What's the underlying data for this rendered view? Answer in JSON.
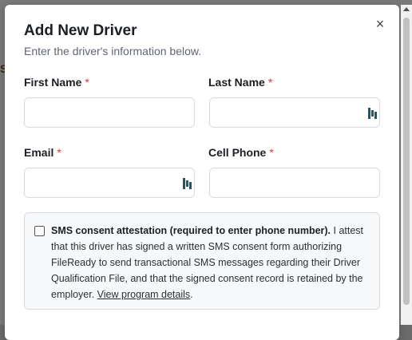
{
  "dialog": {
    "title": "Add New Driver",
    "subtitle": "Enter the driver's information below.",
    "close_glyph": "×"
  },
  "fields": {
    "first_name": {
      "label": "First Name",
      "required_mark": "*",
      "value": "",
      "placeholder": ""
    },
    "last_name": {
      "label": "Last Name",
      "required_mark": "*",
      "value": "",
      "placeholder": "",
      "icon": "password-manager-icon"
    },
    "email": {
      "label": "Email",
      "required_mark": "*",
      "value": "",
      "placeholder": "",
      "icon": "password-manager-icon"
    },
    "cell_phone": {
      "label": "Cell Phone",
      "required_mark": "*",
      "value": "",
      "placeholder": ""
    }
  },
  "consent": {
    "checked": false,
    "bold_text": "SMS consent attestation (required to enter phone number).",
    "body_text": " I attest that this driver has signed a written SMS consent form authorizing FileReady to send transactional SMS messages regarding their Driver Qualification File, and that the signed consent record is retained by the employer. ",
    "link_text": "View program details",
    "trailing": "."
  },
  "colors": {
    "required": "#d23a3a",
    "icon_teal": "#1e5a63"
  }
}
